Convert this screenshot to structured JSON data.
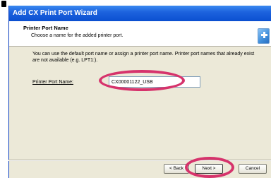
{
  "window": {
    "title": "Add CX Print Port Wizard"
  },
  "header": {
    "title": "Printer Port Name",
    "subtitle": "Choose a name for the added printer port.",
    "icon": "wizard-add-icon"
  },
  "body": {
    "description": "You can use the default port name or assign a printer port name. Printer port names that already exist are not available (e.g. LPT1:).",
    "port_name_label": "Printer Port Name:",
    "port_name_value": "CX00001122_USB"
  },
  "buttons": {
    "back": "< Back",
    "next": "Next >",
    "cancel": "Cancel"
  },
  "colors": {
    "titlebar": "#0b4fd0",
    "highlight_ring": "#d6336c",
    "dialog_bg": "#ece9d8"
  }
}
